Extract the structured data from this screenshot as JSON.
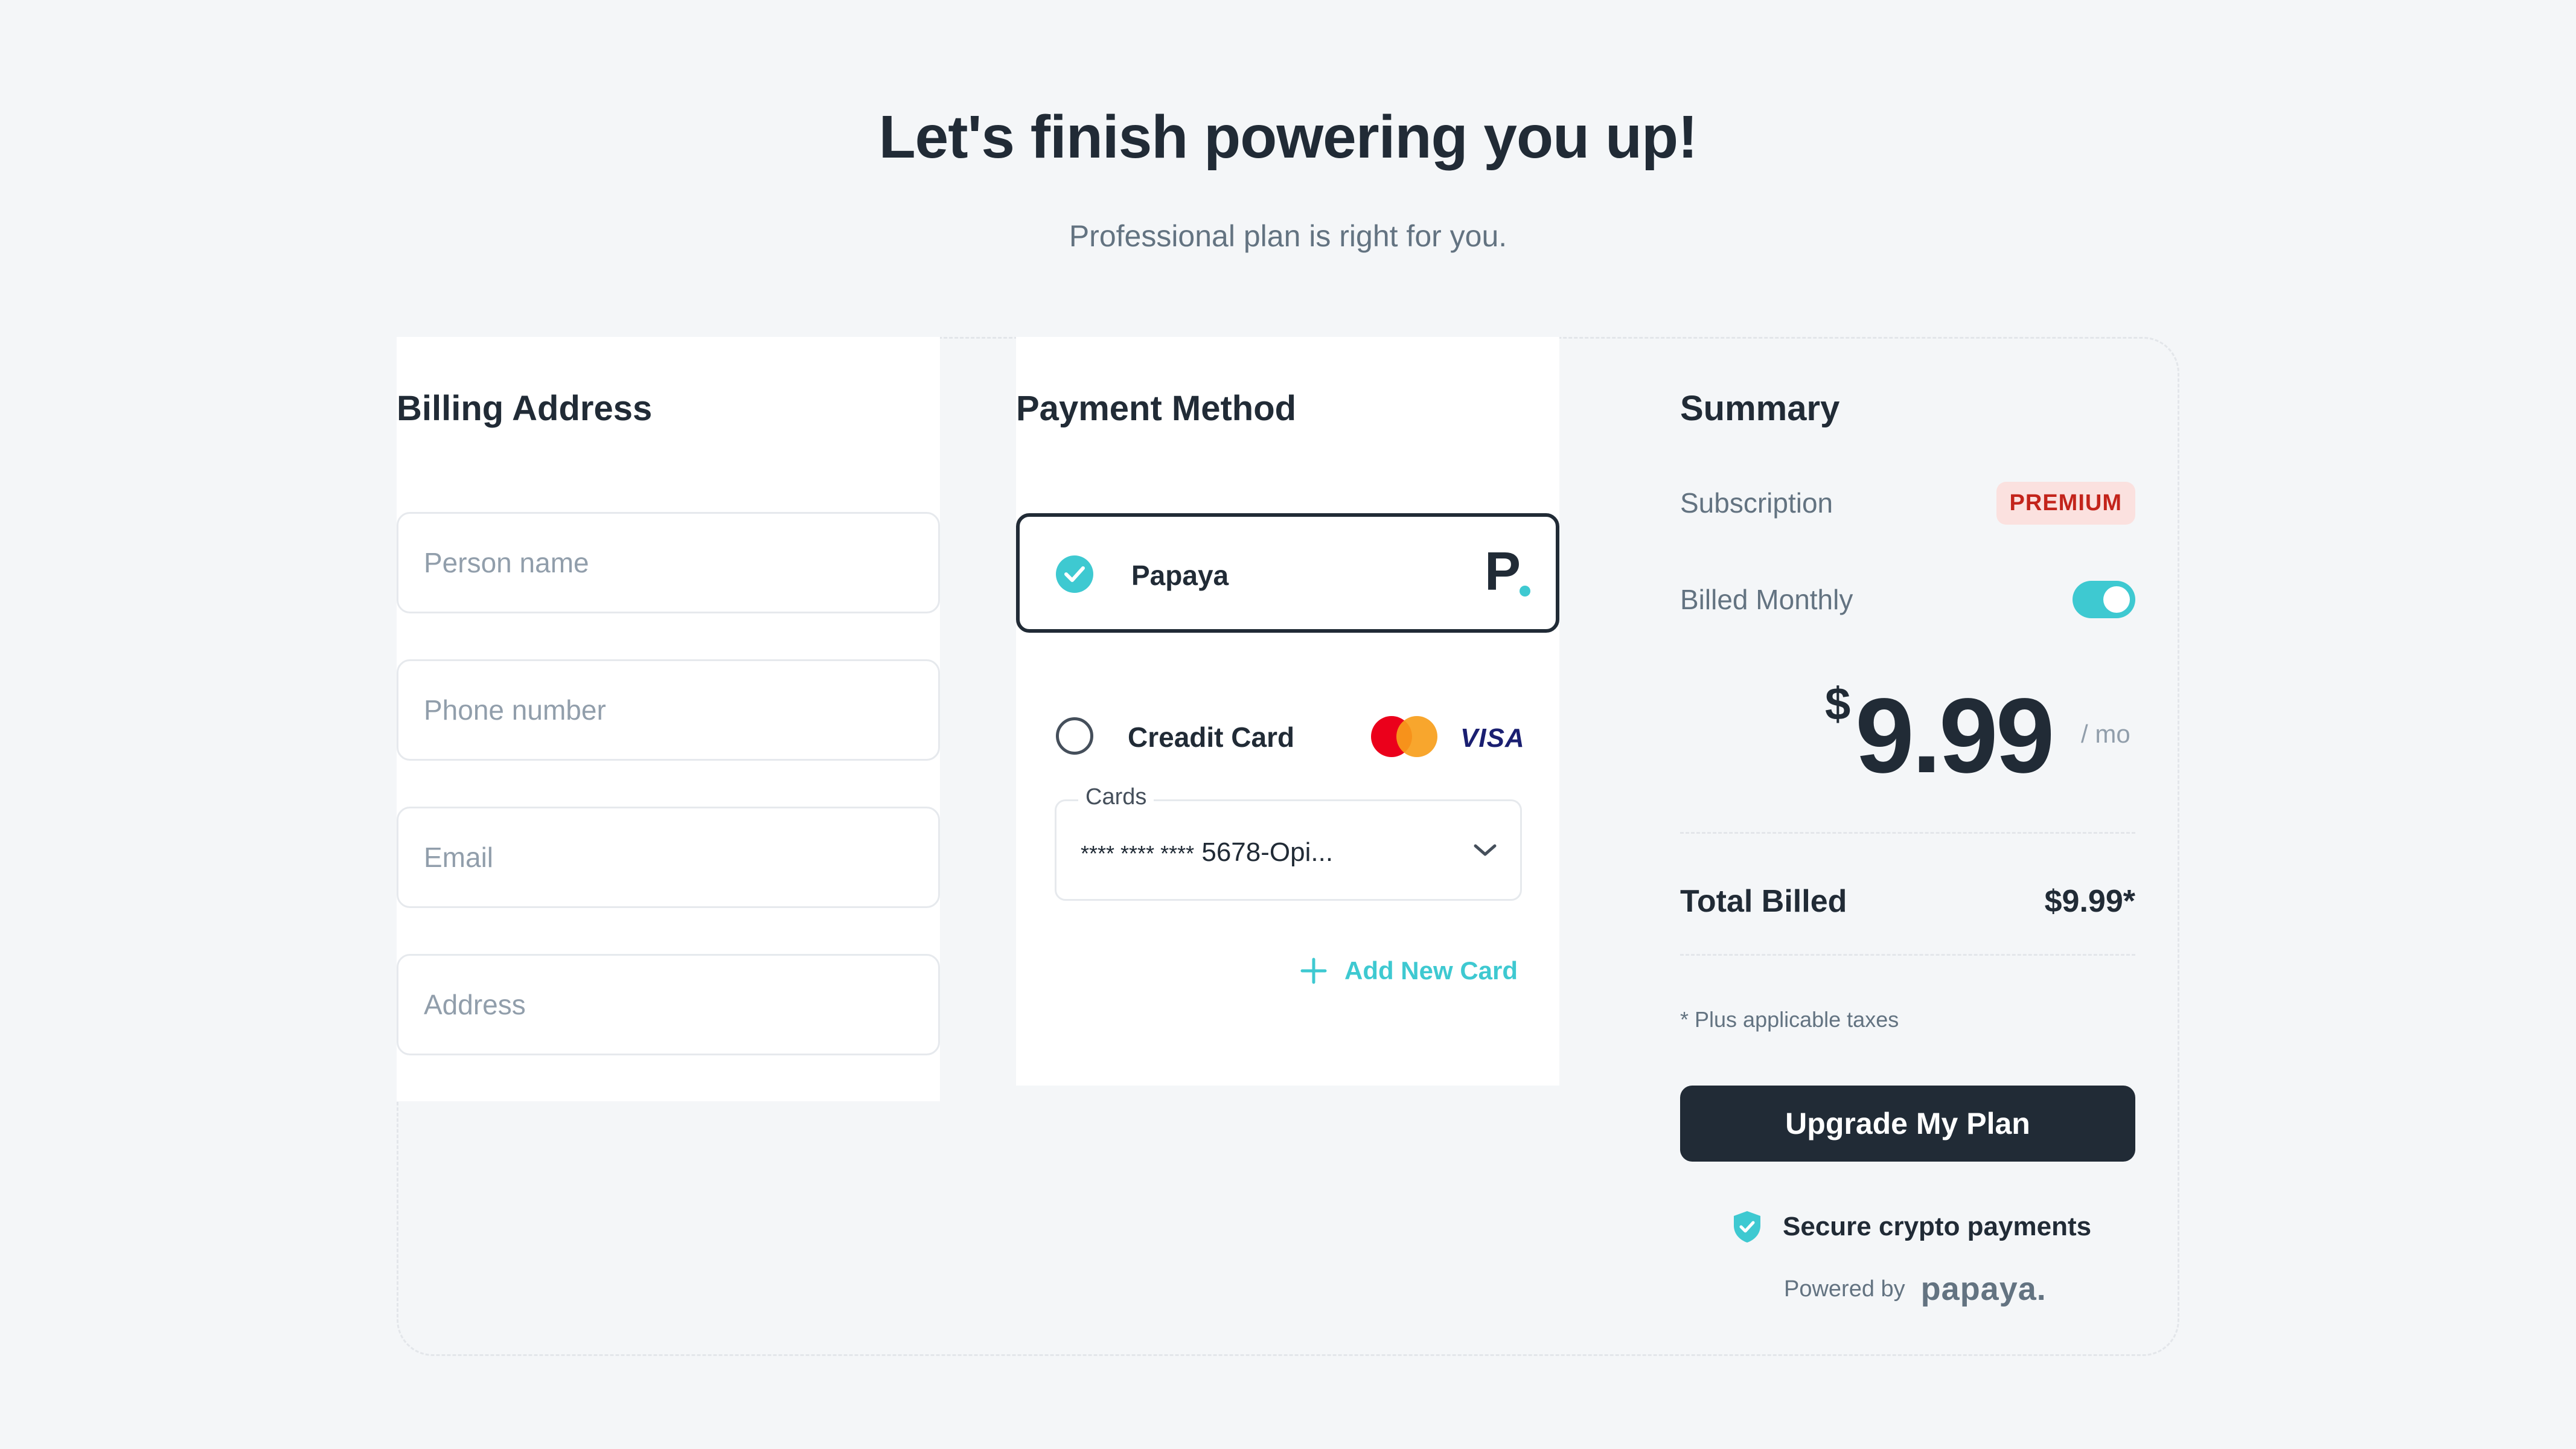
{
  "header": {
    "title": "Let's finish powering you up!",
    "subtitle": "Professional plan is right for you."
  },
  "billing": {
    "title": "Billing Address",
    "fields": [
      {
        "placeholder": "Person name",
        "value": ""
      },
      {
        "placeholder": "Phone number",
        "value": ""
      },
      {
        "placeholder": "Email",
        "value": ""
      },
      {
        "placeholder": "Address",
        "value": ""
      }
    ]
  },
  "payment": {
    "title": "Payment Method",
    "options": [
      {
        "label": "Papaya",
        "selected": true,
        "logo": "papaya-logo",
        "logo_text": "P"
      },
      {
        "label": "Creadit Card",
        "selected": false,
        "logos": [
          "mastercard-logo",
          "visa-logo"
        ],
        "visa_text": "VISA"
      }
    ],
    "cards": {
      "legend": "Cards",
      "value": "**** **** **** 5678 - Opi...",
      "mask": "**** **** ****",
      "number": "5678",
      "separator": "-",
      "name": "Opi..."
    },
    "add_card": "Add New Card"
  },
  "summary": {
    "title": "Summary",
    "subscription_label": "Subscription",
    "subscription_badge": "PREMIUM",
    "billed_label": "Billed Monthly",
    "billed_monthly": true,
    "currency": "$",
    "price": "9.99",
    "period": "/ mo",
    "total_label": "Total Billed",
    "total_value": "$9.99*",
    "tax_note": "* Plus applicable taxes",
    "cta": "Upgrade My Plan",
    "secure_text": "Secure crypto payments",
    "powered_by": "Powered by",
    "brand": "papaya."
  },
  "colors": {
    "accent": "#3ec9d1",
    "dark": "#212b36",
    "badge_bg": "#fbe1df",
    "badge_text": "#c3241b",
    "background": "#f4f6f8"
  }
}
